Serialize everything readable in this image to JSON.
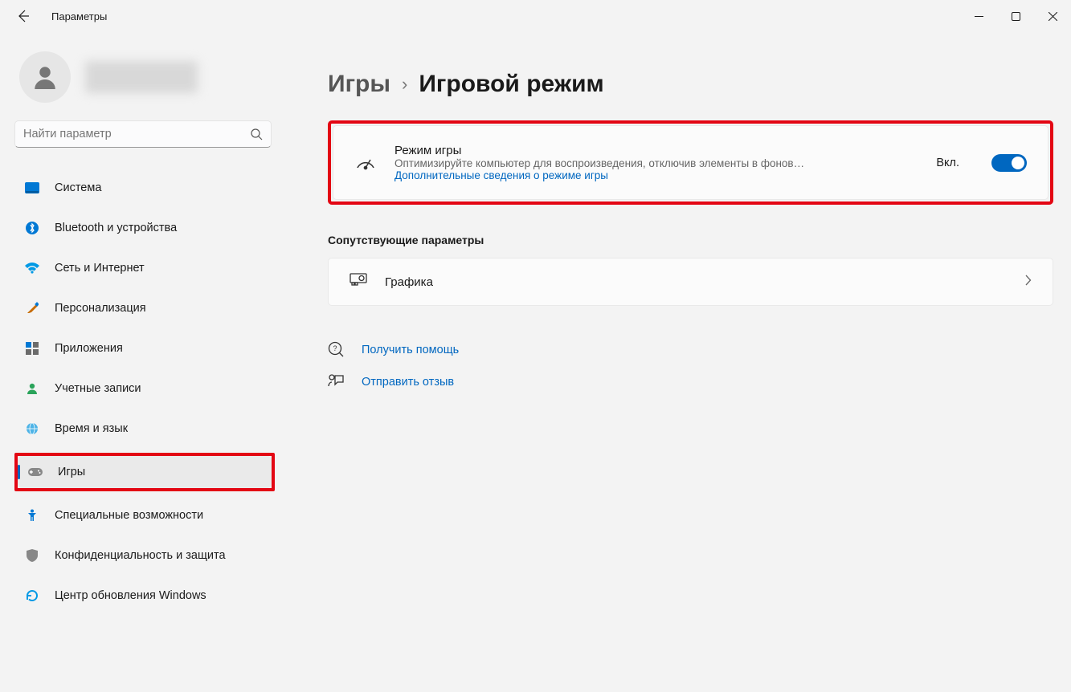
{
  "window": {
    "title": "Параметры"
  },
  "search": {
    "placeholder": "Найти параметр"
  },
  "sidebar": {
    "items": [
      {
        "icon": "system",
        "label": "Система"
      },
      {
        "icon": "bluetooth",
        "label": "Bluetooth и устройства"
      },
      {
        "icon": "network",
        "label": "Сеть и Интернет"
      },
      {
        "icon": "personalization",
        "label": "Персонализация"
      },
      {
        "icon": "apps",
        "label": "Приложения"
      },
      {
        "icon": "accounts",
        "label": "Учетные записи"
      },
      {
        "icon": "time",
        "label": "Время и язык"
      },
      {
        "icon": "games",
        "label": "Игры"
      },
      {
        "icon": "accessibility",
        "label": "Специальные возможности"
      },
      {
        "icon": "privacy",
        "label": "Конфиденциальность и защита"
      },
      {
        "icon": "update",
        "label": "Центр обновления Windows"
      }
    ],
    "active_index": 7,
    "highlighted_index": 7
  },
  "breadcrumb": {
    "root": "Игры",
    "current": "Игровой режим"
  },
  "game_mode": {
    "title": "Режим игры",
    "description": "Оптимизируйте компьютер для воспроизведения, отключив элементы в фонов…",
    "learn_more": "Дополнительные сведения о режиме игры",
    "status_label": "Вкл.",
    "toggle_on": true
  },
  "related_section": {
    "title": "Сопутствующие параметры",
    "items": [
      {
        "icon": "graphics",
        "label": "Графика"
      }
    ]
  },
  "support": {
    "help": "Получить помощь",
    "feedback": "Отправить отзыв"
  }
}
